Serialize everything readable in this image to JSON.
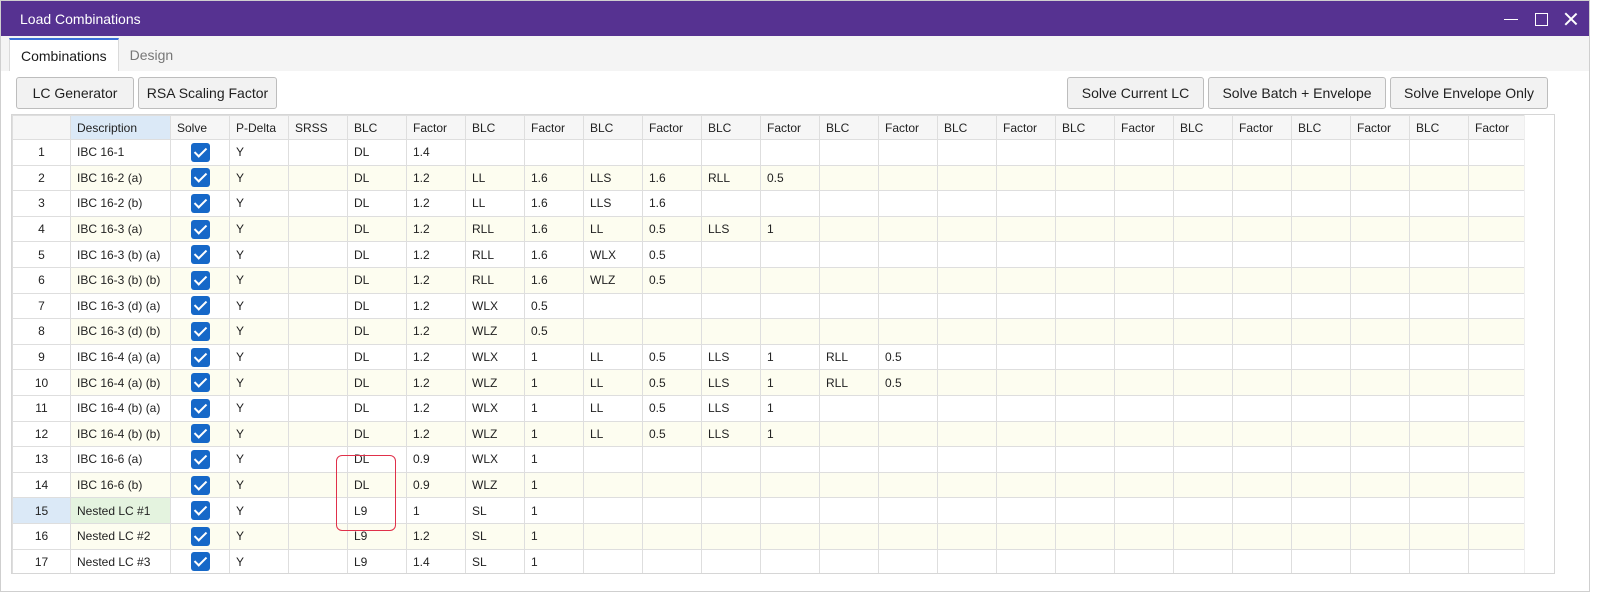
{
  "window": {
    "title": "Load Combinations"
  },
  "tabs": [
    {
      "label": "Combinations",
      "active": true
    },
    {
      "label": "Design",
      "active": false
    }
  ],
  "toolbar": {
    "lc_generator": "LC Generator",
    "rsa_scaling_factor": "RSA Scaling Factor",
    "solve_current_lc": "Solve Current LC",
    "solve_batch_envelope": "Solve Batch + Envelope",
    "solve_envelope_only": "Solve Envelope Only"
  },
  "table": {
    "columns": [
      "",
      "Description",
      "Solve",
      "P-Delta",
      "SRSS",
      "BLC",
      "Factor",
      "BLC",
      "Factor",
      "BLC",
      "Factor",
      "BLC",
      "Factor",
      "BLC",
      "Factor",
      "BLC",
      "Factor",
      "BLC",
      "Factor",
      "BLC",
      "Factor",
      "BLC",
      "Factor",
      "BLC",
      "Factor"
    ],
    "rows": [
      {
        "num": "1",
        "desc": "IBC 16-1",
        "solve": true,
        "pdelta": "Y",
        "srss": "",
        "pairs": [
          [
            "DL",
            "1.4"
          ]
        ]
      },
      {
        "num": "2",
        "desc": "IBC 16-2 (a)",
        "solve": true,
        "pdelta": "Y",
        "srss": "",
        "pairs": [
          [
            "DL",
            "1.2"
          ],
          [
            "LL",
            "1.6"
          ],
          [
            "LLS",
            "1.6"
          ],
          [
            "RLL",
            "0.5"
          ]
        ]
      },
      {
        "num": "3",
        "desc": "IBC 16-2 (b)",
        "solve": true,
        "pdelta": "Y",
        "srss": "",
        "pairs": [
          [
            "DL",
            "1.2"
          ],
          [
            "LL",
            "1.6"
          ],
          [
            "LLS",
            "1.6"
          ]
        ]
      },
      {
        "num": "4",
        "desc": "IBC 16-3 (a)",
        "solve": true,
        "pdelta": "Y",
        "srss": "",
        "pairs": [
          [
            "DL",
            "1.2"
          ],
          [
            "RLL",
            "1.6"
          ],
          [
            "LL",
            "0.5"
          ],
          [
            "LLS",
            "1"
          ]
        ]
      },
      {
        "num": "5",
        "desc": "IBC 16-3 (b) (a)",
        "solve": true,
        "pdelta": "Y",
        "srss": "",
        "pairs": [
          [
            "DL",
            "1.2"
          ],
          [
            "RLL",
            "1.6"
          ],
          [
            "WLX",
            "0.5"
          ]
        ]
      },
      {
        "num": "6",
        "desc": "IBC 16-3 (b) (b)",
        "solve": true,
        "pdelta": "Y",
        "srss": "",
        "pairs": [
          [
            "DL",
            "1.2"
          ],
          [
            "RLL",
            "1.6"
          ],
          [
            "WLZ",
            "0.5"
          ]
        ]
      },
      {
        "num": "7",
        "desc": "IBC 16-3 (d) (a)",
        "solve": true,
        "pdelta": "Y",
        "srss": "",
        "pairs": [
          [
            "DL",
            "1.2"
          ],
          [
            "WLX",
            "0.5"
          ]
        ]
      },
      {
        "num": "8",
        "desc": "IBC 16-3 (d) (b)",
        "solve": true,
        "pdelta": "Y",
        "srss": "",
        "pairs": [
          [
            "DL",
            "1.2"
          ],
          [
            "WLZ",
            "0.5"
          ]
        ]
      },
      {
        "num": "9",
        "desc": "IBC 16-4 (a) (a)",
        "solve": true,
        "pdelta": "Y",
        "srss": "",
        "pairs": [
          [
            "DL",
            "1.2"
          ],
          [
            "WLX",
            "1"
          ],
          [
            "LL",
            "0.5"
          ],
          [
            "LLS",
            "1"
          ],
          [
            "RLL",
            "0.5"
          ]
        ]
      },
      {
        "num": "10",
        "desc": "IBC 16-4 (a) (b)",
        "solve": true,
        "pdelta": "Y",
        "srss": "",
        "pairs": [
          [
            "DL",
            "1.2"
          ],
          [
            "WLZ",
            "1"
          ],
          [
            "LL",
            "0.5"
          ],
          [
            "LLS",
            "1"
          ],
          [
            "RLL",
            "0.5"
          ]
        ]
      },
      {
        "num": "11",
        "desc": "IBC 16-4 (b) (a)",
        "solve": true,
        "pdelta": "Y",
        "srss": "",
        "pairs": [
          [
            "DL",
            "1.2"
          ],
          [
            "WLX",
            "1"
          ],
          [
            "LL",
            "0.5"
          ],
          [
            "LLS",
            "1"
          ]
        ]
      },
      {
        "num": "12",
        "desc": "IBC 16-4 (b) (b)",
        "solve": true,
        "pdelta": "Y",
        "srss": "",
        "pairs": [
          [
            "DL",
            "1.2"
          ],
          [
            "WLZ",
            "1"
          ],
          [
            "LL",
            "0.5"
          ],
          [
            "LLS",
            "1"
          ]
        ]
      },
      {
        "num": "13",
        "desc": "IBC 16-6 (a)",
        "solve": true,
        "pdelta": "Y",
        "srss": "",
        "pairs": [
          [
            "DL",
            "0.9"
          ],
          [
            "WLX",
            "1"
          ]
        ]
      },
      {
        "num": "14",
        "desc": "IBC 16-6 (b)",
        "solve": true,
        "pdelta": "Y",
        "srss": "",
        "pairs": [
          [
            "DL",
            "0.9"
          ],
          [
            "WLZ",
            "1"
          ]
        ]
      },
      {
        "num": "15",
        "desc": "Nested LC #1",
        "solve": true,
        "pdelta": "Y",
        "srss": "",
        "pairs": [
          [
            "L9",
            "1"
          ],
          [
            "SL",
            "1"
          ]
        ],
        "selected": true
      },
      {
        "num": "16",
        "desc": "Nested LC #2",
        "solve": true,
        "pdelta": "Y",
        "srss": "",
        "pairs": [
          [
            "L9",
            "1.2"
          ],
          [
            "SL",
            "1"
          ]
        ]
      },
      {
        "num": "17",
        "desc": "Nested LC #3",
        "solve": true,
        "pdelta": "Y",
        "srss": "",
        "pairs": [
          [
            "L9",
            "1.4"
          ],
          [
            "SL",
            "1"
          ]
        ]
      }
    ]
  }
}
